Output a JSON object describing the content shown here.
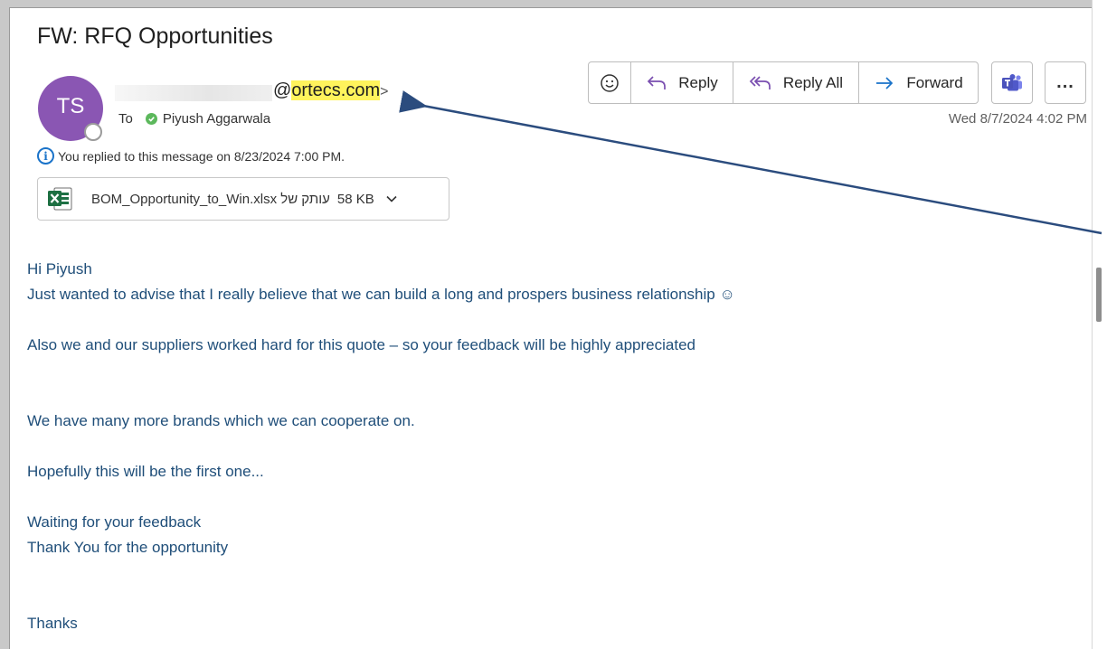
{
  "message": {
    "subject": "FW: RFQ Opportunities",
    "avatar_initials": "TS",
    "sender_email_at": "@",
    "sender_email_domain": "ortecs.com",
    "sender_email_close": ">",
    "to_label": "To",
    "recipient": "Piyush Aggarwala",
    "replied_notice": "You replied to this message on 8/23/2024 7:00 PM.",
    "date": "Wed 8/7/2024 4:02 PM"
  },
  "attachment": {
    "name": "עותק של BOM_Opportunity_to_Win.xlsx",
    "size": "58 KB",
    "icon": "excel-icon"
  },
  "toolbar": {
    "emoji_icon": "smiley-icon",
    "reply_label": "Reply",
    "reply_all_label": "Reply All",
    "forward_label": "Forward",
    "teams_icon": "teams-icon",
    "more_label": "..."
  },
  "body": {
    "line1": "Hi Piyush",
    "line2": "Just wanted to advise that I really believe that we can build a long and prospers business relationship ☺",
    "line3": "Also we and our suppliers worked hard for this quote – so your feedback will be highly appreciated",
    "line4": "We have many more brands which we can cooperate on.",
    "line5": "Hopefully this will be the first one...",
    "line6": "Waiting for your feedback",
    "line7": "Thank You for the opportunity",
    "line8": "Thanks"
  },
  "colors": {
    "accent": "#1a73c9",
    "body_text": "#1f4e79",
    "avatar": "#8a56b3",
    "highlight": "#fff35c",
    "arrow": "#2b4c7e"
  }
}
